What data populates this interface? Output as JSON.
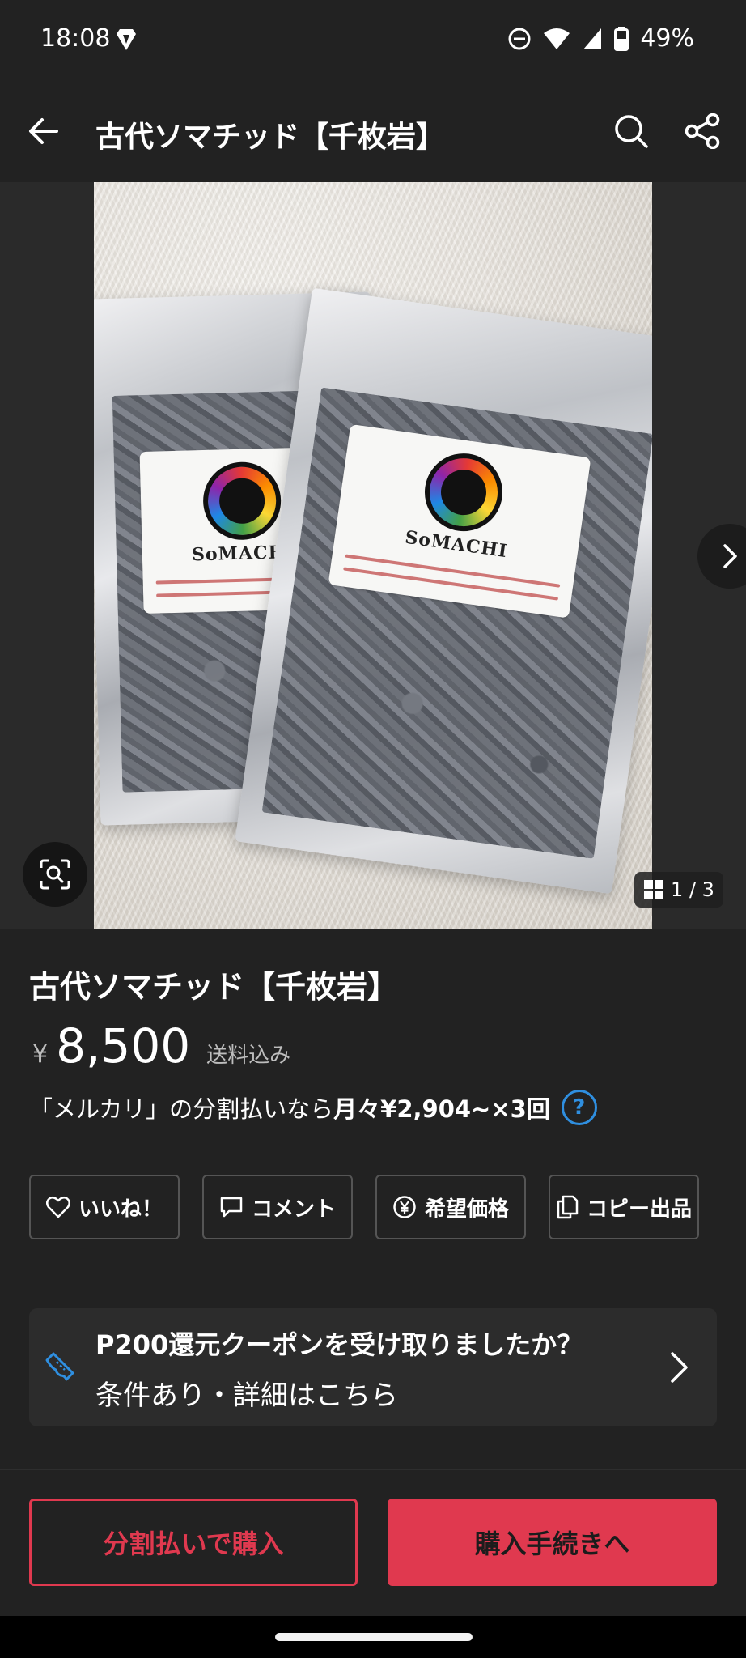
{
  "status_bar": {
    "time": "18:08",
    "battery": "49%"
  },
  "app_bar": {
    "title": "古代ソマチッド【千枚岩】"
  },
  "carousel": {
    "photo_label_brand": "SoMACHI",
    "counter": "1 / 3"
  },
  "product": {
    "title": "古代ソマチッド【千枚岩】",
    "price_currency": "¥",
    "price": "8,500",
    "shipping": "送料込み",
    "installment_prefix": "「メルカリ」の分割払いなら",
    "installment_bold": "月々¥2,904~×3回",
    "help_glyph": "?"
  },
  "actions": [
    {
      "label": "いいね！",
      "icon": "heart-icon"
    },
    {
      "label": "コメント",
      "icon": "comment-icon"
    },
    {
      "label": "希望価格",
      "icon": "yen-icon"
    },
    {
      "label": "コピー出品",
      "icon": "copy-icon"
    }
  ],
  "coupon": {
    "title": "P200還元クーポンを受け取りましたか？",
    "subtitle": "条件あり・詳細はこちら"
  },
  "bottom_bar": {
    "split_label": "分割払いで購入",
    "buy_label": "購入手続きへ"
  },
  "colors": {
    "accent": "#e0394f",
    "link_blue": "#2f8fe0",
    "background": "#222222"
  }
}
